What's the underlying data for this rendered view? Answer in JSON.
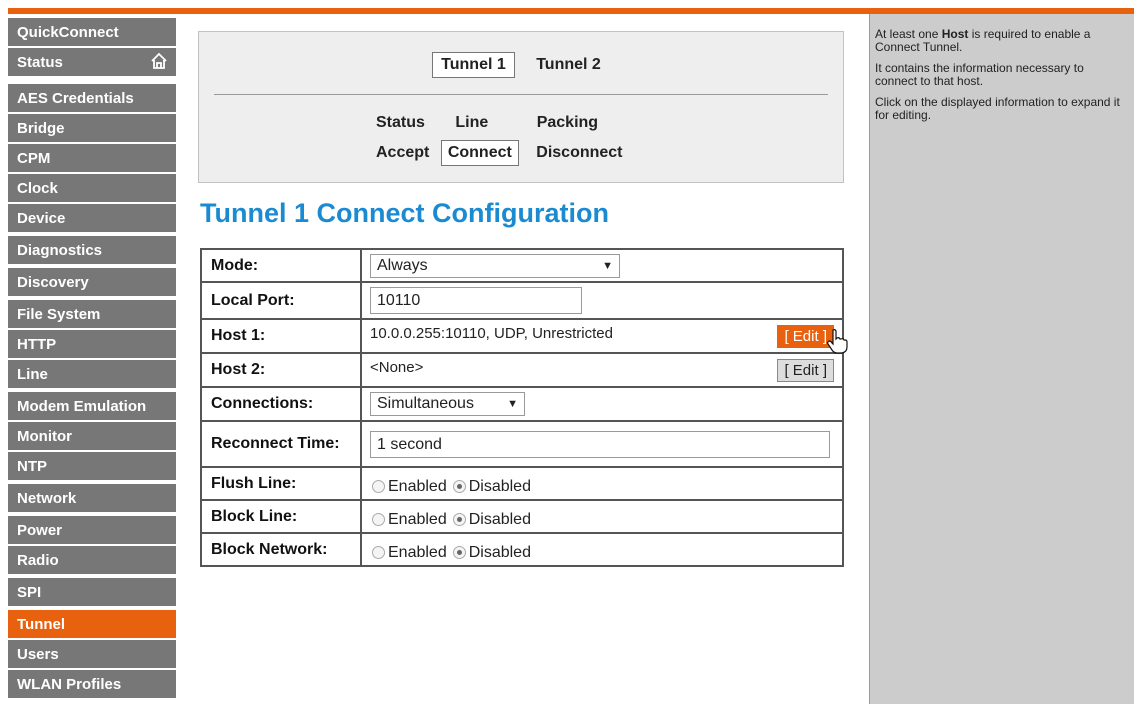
{
  "colors": {
    "accent": "#e8610e",
    "sidebar": "#777777",
    "heading": "#1b8bd1",
    "help_bg": "#cccccc"
  },
  "sidebar": {
    "items": [
      {
        "label": "QuickConnect"
      },
      {
        "label": "Status",
        "icon": "home-icon"
      },
      {
        "label": "AES Credentials"
      },
      {
        "label": "Bridge"
      },
      {
        "label": "CPM"
      },
      {
        "label": "Clock"
      },
      {
        "label": "Device"
      },
      {
        "label": "Diagnostics"
      },
      {
        "label": "Discovery"
      },
      {
        "label": "File System"
      },
      {
        "label": "HTTP"
      },
      {
        "label": "Line"
      },
      {
        "label": "Modem Emulation"
      },
      {
        "label": "Monitor"
      },
      {
        "label": "NTP"
      },
      {
        "label": "Network"
      },
      {
        "label": "Power"
      },
      {
        "label": "Radio"
      },
      {
        "label": "SPI"
      },
      {
        "label": "Tunnel",
        "active": true
      },
      {
        "label": "Users"
      },
      {
        "label": "WLAN Profiles"
      }
    ]
  },
  "tabs": {
    "tunnel1": "Tunnel 1",
    "tunnel2": "Tunnel 2"
  },
  "subtabs": {
    "status": "Status",
    "line": "Line",
    "packing": "Packing",
    "accept": "Accept",
    "connect": "Connect",
    "disconnect": "Disconnect"
  },
  "page_title": "Tunnel 1 Connect Configuration",
  "config": {
    "mode": {
      "label": "Mode:",
      "value": "Always"
    },
    "local_port": {
      "label": "Local Port:",
      "value": "10110"
    },
    "host1": {
      "label": "Host 1:",
      "value": "10.0.0.255:10110, UDP, Unrestricted",
      "edit": "[ Edit ]"
    },
    "host2": {
      "label": "Host 2:",
      "value": "<None>",
      "edit": "[ Edit ]"
    },
    "connections": {
      "label": "Connections:",
      "value": "Simultaneous"
    },
    "reconnect": {
      "label": "Reconnect Time:",
      "value": "1 second"
    },
    "flush_line": {
      "label": "Flush Line:",
      "enabled": "Enabled",
      "disabled": "Disabled",
      "selected": "Disabled"
    },
    "block_line": {
      "label": "Block Line:",
      "enabled": "Enabled",
      "disabled": "Disabled",
      "selected": "Disabled"
    },
    "block_network": {
      "label": "Block Network:",
      "enabled": "Enabled",
      "disabled": "Disabled",
      "selected": "Disabled"
    }
  },
  "help": {
    "p1_pre": "At least one ",
    "p1_bold": "Host",
    "p1_post": " is required to enable a Connect Tunnel.",
    "p2": "It contains the information necessary to connect to that host.",
    "p3": "Click on the displayed information to expand it for editing."
  }
}
